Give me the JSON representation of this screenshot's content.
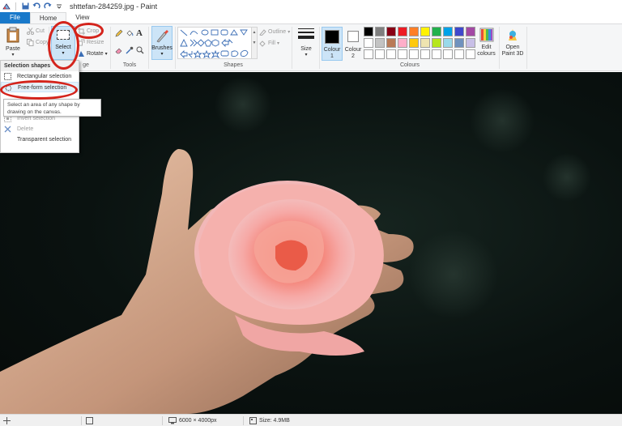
{
  "window": {
    "title": "shttefan-284259.jpg - Paint"
  },
  "tabs": [
    {
      "label": "File"
    },
    {
      "label": "Home"
    },
    {
      "label": "View"
    }
  ],
  "ribbon": {
    "clipboard": {
      "paste": "Paste",
      "cut": "Cut",
      "copy": "Copy"
    },
    "image": {
      "select": "Select",
      "crop": "Crop",
      "resize": "Resize",
      "rotate": "Rotate",
      "group_label": "ge"
    },
    "tools": {
      "group_label": "Tools"
    },
    "brushes": "Brushes",
    "shapes": {
      "group_label": "Shapes",
      "outline": "Outline",
      "fill": "Fill"
    },
    "size": "Size",
    "colours": {
      "colour1": "Colour 1",
      "colour2": "Colour 2",
      "group_label": "Colours",
      "edit": "Edit colours",
      "colour1_value": "#000000",
      "colour2_value": "#ffffff",
      "palette": [
        "#000000",
        "#7f7f7f",
        "#880015",
        "#ed1c24",
        "#ff7f27",
        "#fff200",
        "#22b14c",
        "#00a2e8",
        "#3f48cc",
        "#a349a4",
        "#ffffff",
        "#c3c3c3",
        "#b97a57",
        "#ffaec9",
        "#ffc90e",
        "#efe4b0",
        "#b5e61d",
        "#99d9ea",
        "#7092be",
        "#c8bfe7",
        "#ffffff",
        "#ffffff",
        "#ffffff",
        "#ffffff",
        "#ffffff",
        "#ffffff",
        "#ffffff",
        "#ffffff",
        "#ffffff",
        "#ffffff"
      ]
    },
    "paint3d": "Open Paint 3D"
  },
  "select_menu": {
    "header": "Selection shapes",
    "items": [
      {
        "label": "Rectangular selection"
      },
      {
        "label": "Free-form selection"
      },
      {
        "label": "Invert selection"
      },
      {
        "label": "Delete"
      },
      {
        "label": "Transparent selection"
      }
    ],
    "tooltip": "Select an area of any shape by drawing on the canvas."
  },
  "status": {
    "dimensions": "6000 × 4000px",
    "size": "Size: 4.9MB"
  },
  "colors": {
    "accent": "#1979ca",
    "annotation": "#d4241c"
  }
}
